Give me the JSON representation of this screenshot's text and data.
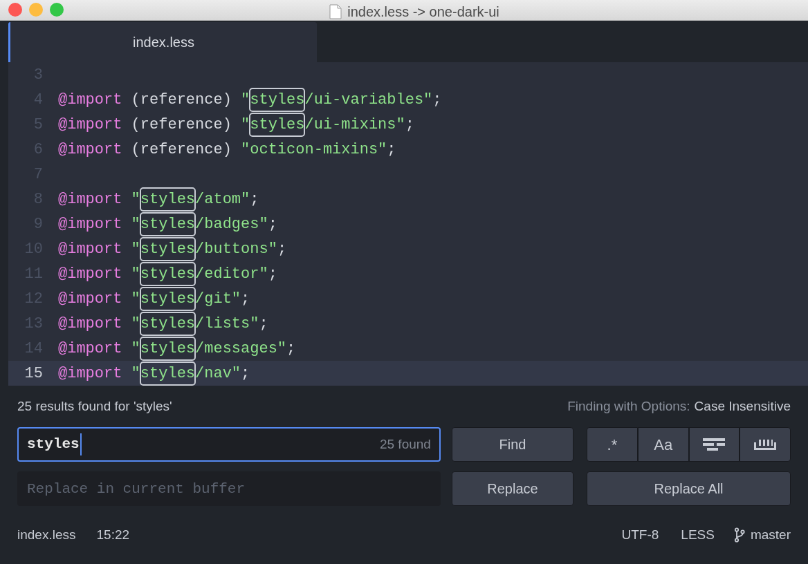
{
  "window": {
    "title": "index.less -> one-dark-ui"
  },
  "tabs": [
    {
      "label": "index.less",
      "selected": true
    }
  ],
  "editor": {
    "lines": [
      {
        "number": "3",
        "current": false
      },
      {
        "number": "4",
        "current": false,
        "tokens": [
          {
            "kind": "keyword",
            "text": "@import"
          },
          {
            "kind": "plain",
            "text": " (reference) "
          },
          {
            "kind": "string",
            "text": "\""
          },
          {
            "kind": "match",
            "text": "styles"
          },
          {
            "kind": "string",
            "text": "/ui-variables\""
          },
          {
            "kind": "plain",
            "text": ";"
          }
        ]
      },
      {
        "number": "5",
        "current": false,
        "tokens": [
          {
            "kind": "keyword",
            "text": "@import"
          },
          {
            "kind": "plain",
            "text": " (reference) "
          },
          {
            "kind": "string",
            "text": "\""
          },
          {
            "kind": "match",
            "text": "styles"
          },
          {
            "kind": "string",
            "text": "/ui-mixins\""
          },
          {
            "kind": "plain",
            "text": ";"
          }
        ]
      },
      {
        "number": "6",
        "current": false,
        "tokens": [
          {
            "kind": "keyword",
            "text": "@import"
          },
          {
            "kind": "plain",
            "text": " (reference) "
          },
          {
            "kind": "string",
            "text": "\"octicon-mixins\""
          },
          {
            "kind": "plain",
            "text": ";"
          }
        ]
      },
      {
        "number": "7",
        "current": false
      },
      {
        "number": "8",
        "current": false,
        "tokens": [
          {
            "kind": "keyword",
            "text": "@import"
          },
          {
            "kind": "string",
            "text": " \""
          },
          {
            "kind": "match",
            "text": "styles"
          },
          {
            "kind": "string",
            "text": "/atom\""
          },
          {
            "kind": "plain",
            "text": ";"
          }
        ]
      },
      {
        "number": "9",
        "current": false,
        "tokens": [
          {
            "kind": "keyword",
            "text": "@import"
          },
          {
            "kind": "string",
            "text": " \""
          },
          {
            "kind": "match",
            "text": "styles"
          },
          {
            "kind": "string",
            "text": "/badges\""
          },
          {
            "kind": "plain",
            "text": ";"
          }
        ]
      },
      {
        "number": "10",
        "current": false,
        "tokens": [
          {
            "kind": "keyword",
            "text": "@import"
          },
          {
            "kind": "string",
            "text": " \""
          },
          {
            "kind": "match",
            "text": "styles"
          },
          {
            "kind": "string",
            "text": "/buttons\""
          },
          {
            "kind": "plain",
            "text": ";"
          }
        ]
      },
      {
        "number": "11",
        "current": false,
        "tokens": [
          {
            "kind": "keyword",
            "text": "@import"
          },
          {
            "kind": "string",
            "text": " \""
          },
          {
            "kind": "match",
            "text": "styles"
          },
          {
            "kind": "string",
            "text": "/editor\""
          },
          {
            "kind": "plain",
            "text": ";"
          }
        ]
      },
      {
        "number": "12",
        "current": false,
        "tokens": [
          {
            "kind": "keyword",
            "text": "@import"
          },
          {
            "kind": "string",
            "text": " \""
          },
          {
            "kind": "match",
            "text": "styles"
          },
          {
            "kind": "string",
            "text": "/git\""
          },
          {
            "kind": "plain",
            "text": ";"
          }
        ]
      },
      {
        "number": "13",
        "current": false,
        "tokens": [
          {
            "kind": "keyword",
            "text": "@import"
          },
          {
            "kind": "string",
            "text": " \""
          },
          {
            "kind": "match",
            "text": "styles"
          },
          {
            "kind": "string",
            "text": "/lists\""
          },
          {
            "kind": "plain",
            "text": ";"
          }
        ]
      },
      {
        "number": "14",
        "current": false,
        "tokens": [
          {
            "kind": "keyword",
            "text": "@import"
          },
          {
            "kind": "string",
            "text": " \""
          },
          {
            "kind": "match",
            "text": "styles"
          },
          {
            "kind": "string",
            "text": "/messages\""
          },
          {
            "kind": "plain",
            "text": ";"
          }
        ]
      },
      {
        "number": "15",
        "current": true,
        "tokens": [
          {
            "kind": "keyword",
            "text": "@import"
          },
          {
            "kind": "string",
            "text": " \""
          },
          {
            "kind": "match",
            "text": "styles"
          },
          {
            "kind": "string",
            "text": "/nav\""
          },
          {
            "kind": "plain",
            "text": ";"
          }
        ]
      }
    ]
  },
  "find_panel": {
    "results": "25 results found for 'styles'",
    "options_label": "Finding with Options:",
    "options_value": "Case Insensitive",
    "find_field": {
      "value": "styles",
      "count": "25 found"
    },
    "find_button": "Find",
    "option_buttons": [
      {
        "kind": "regex",
        "label": ".*",
        "selected": false
      },
      {
        "kind": "case",
        "label": "Aa",
        "selected": false
      },
      {
        "kind": "selection",
        "selected": false
      },
      {
        "kind": "word",
        "selected": false
      }
    ],
    "replace_field": {
      "placeholder": "Replace in current buffer"
    },
    "replace_button": "Replace",
    "replace_all_button": "Replace All"
  },
  "status_bar": {
    "file": "index.less",
    "cursor": "15:22",
    "encoding": "UTF-8",
    "grammar": "LESS",
    "branch": "master"
  }
}
